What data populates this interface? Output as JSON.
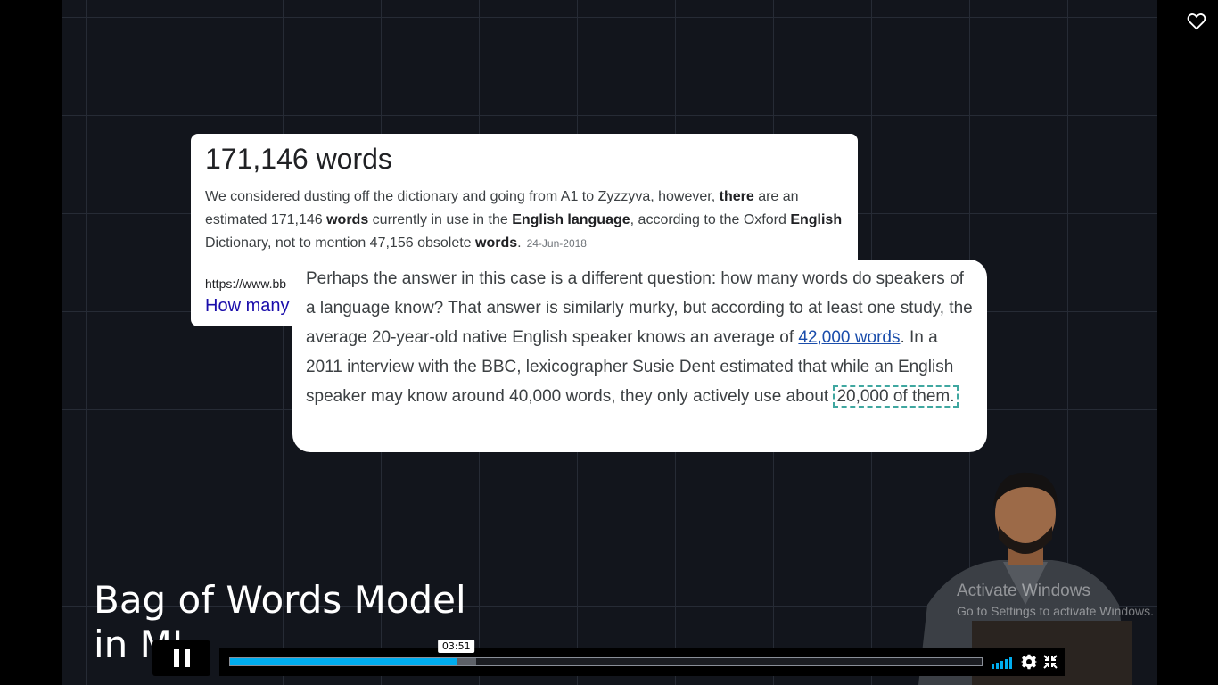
{
  "card_search": {
    "heading": "171,146 words",
    "snippet": [
      {
        "t": "We considered dusting off the dictionary and going from A1 to Zyzzyva, however, ",
        "b": false
      },
      {
        "t": "there",
        "b": true
      },
      {
        "t": " are an estimated 171,146 ",
        "b": false
      },
      {
        "t": "words",
        "b": true
      },
      {
        "t": " currently in use in the ",
        "b": false
      },
      {
        "t": "English language",
        "b": true
      },
      {
        "t": ", according to the Oxford ",
        "b": false
      },
      {
        "t": "English",
        "b": true
      },
      {
        "t": " Dictionary, not to mention 47,156 obsolete ",
        "b": false
      },
      {
        "t": "words",
        "b": true
      },
      {
        "t": ".",
        "b": false
      }
    ],
    "date": "24-Jun-2018",
    "url": "https://www.bb",
    "link": "How many"
  },
  "card_quote": {
    "text_1": "Perhaps the answer in this case is a different question: how many words do speakers of a language know? That answer is similarly murky, but according to at least one study, the average 20-year-old native English speaker knows an average of ",
    "link": "42,000 words",
    "text_2": ". In a 2011 interview with the BBC, lexicographer Susie Dent estimated that while an English speaker may know around 40,000 words, they only actively use about ",
    "highlight": "20,000 of them."
  },
  "title_overlay": [
    "Bag of Words Model",
    "in ML"
  ],
  "watermark": {
    "line1": "Activate Windows",
    "line2": "Go to Settings to activate Windows."
  },
  "player": {
    "current_time": "03:51",
    "progress_fraction": 0.301,
    "buffered_fraction": 0.327,
    "state": "playing",
    "icons": {
      "play_toggle": "pause-icon",
      "volume": "volume-icon",
      "settings": "gear-icon",
      "fullscreen": "exit-fullscreen-icon",
      "like": "heart-icon"
    },
    "accent_color": "#00adef"
  }
}
